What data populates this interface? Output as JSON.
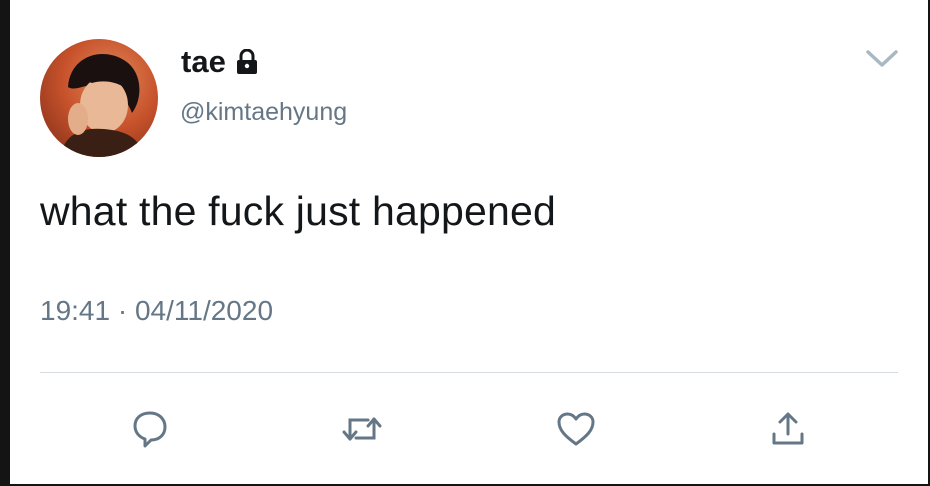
{
  "user": {
    "display_name": "tae",
    "handle": "@kimtaehyung",
    "protected_icon": "lock-icon",
    "avatar": "avatar-photo"
  },
  "tweet": {
    "text": "what the fuck just happened",
    "time": "19:41",
    "separator": "·",
    "date": "04/11/2020"
  },
  "actions": [
    {
      "name": "reply",
      "icon": "speech-bubble-icon"
    },
    {
      "name": "retweet",
      "icon": "retweet-icon"
    },
    {
      "name": "like",
      "icon": "heart-icon"
    },
    {
      "name": "share",
      "icon": "share-icon"
    }
  ],
  "menu_icon": "chevron-down-icon",
  "colors": {
    "text": "#14171a",
    "secondary": "#657786",
    "icon": "#657786",
    "divider": "#d4dadf"
  }
}
